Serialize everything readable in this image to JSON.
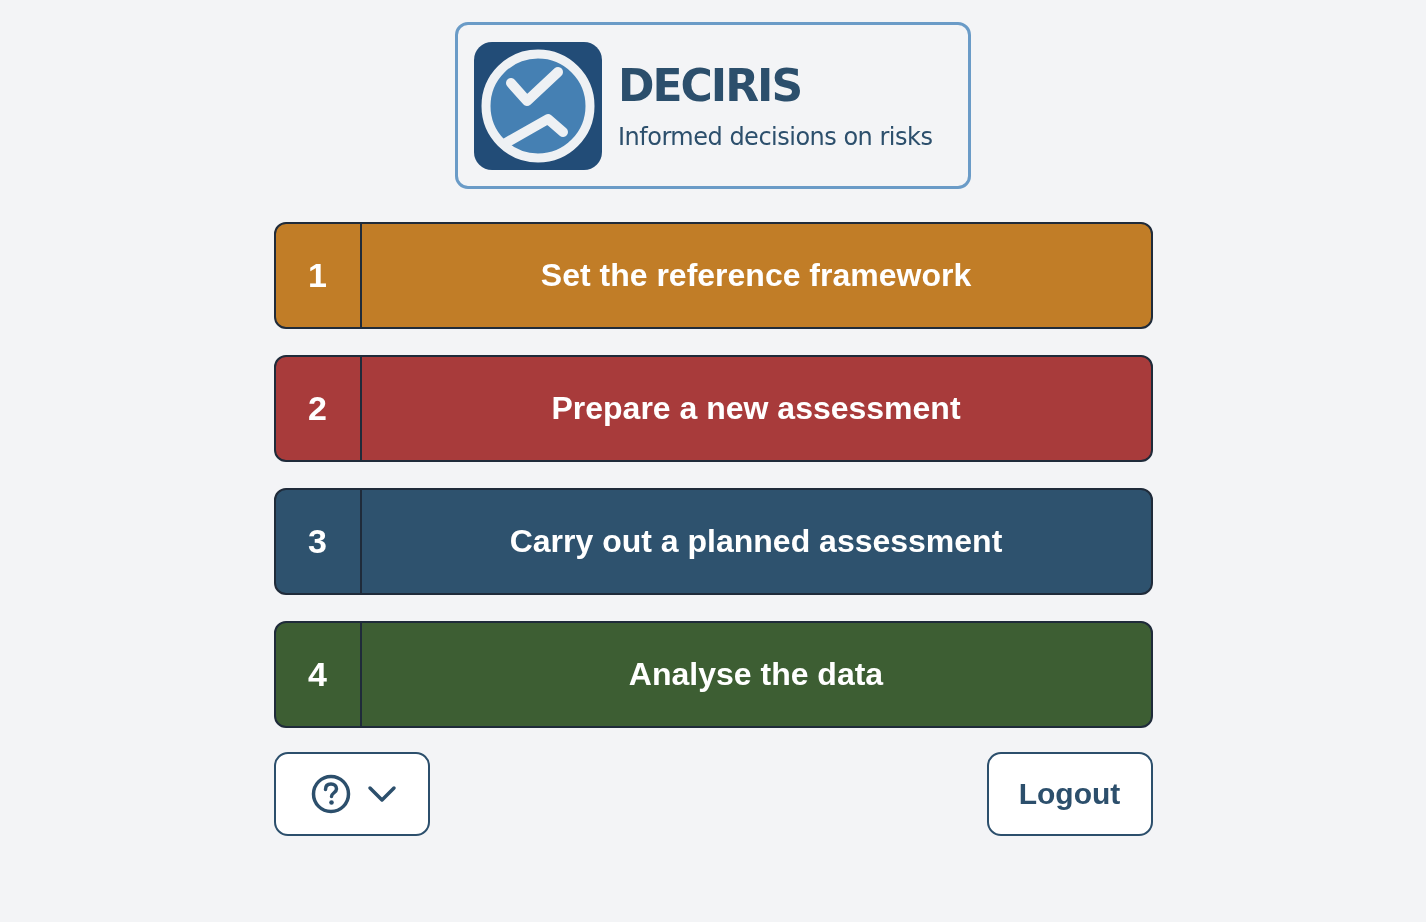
{
  "logo": {
    "title": "DECIRIS",
    "tagline": "Informed decisions on risks"
  },
  "steps": [
    {
      "number": "1",
      "label": "Set the reference framework",
      "color": "#c17d27"
    },
    {
      "number": "2",
      "label": "Prepare a new assessment",
      "color": "#a83b3b"
    },
    {
      "number": "3",
      "label": "Carry out a planned assessment",
      "color": "#2e526e"
    },
    {
      "number": "4",
      "label": "Analyse the data",
      "color": "#3d5e33"
    }
  ],
  "help_menu": {
    "expanded": false
  },
  "logout_button": {
    "label": "Logout"
  }
}
